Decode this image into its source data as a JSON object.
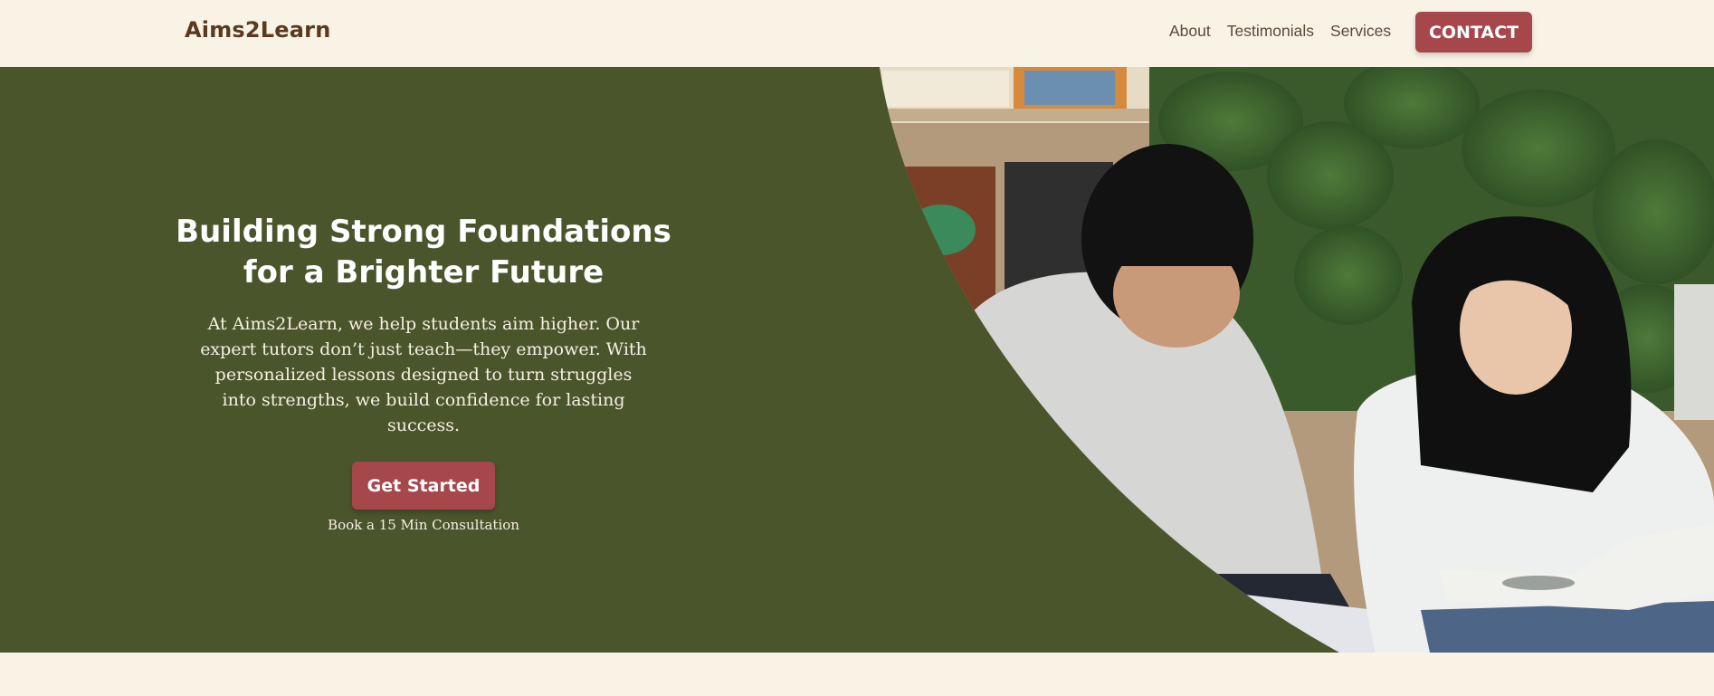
{
  "header": {
    "logo": "Aims2Learn",
    "nav": [
      "About",
      "Testimonials",
      "Services"
    ],
    "contact_label": "CONTACT"
  },
  "hero": {
    "title_line1": "Building Strong Foundations",
    "title_line2": "for a Brighter Future",
    "description": "At Aims2Learn, we help students aim higher. Our expert tutors don’t just teach—they empower. With personalized lessons designed to turn struggles into strengths, we build confidence for lasting success.",
    "cta_label": "Get Started",
    "cta_sub": "Book a 15 Min Consultation"
  },
  "colors": {
    "hero_bg": "#4b552c",
    "accent": "#a6474c",
    "page_bg": "#f9f3e6",
    "logo": "#5a3a1e"
  }
}
